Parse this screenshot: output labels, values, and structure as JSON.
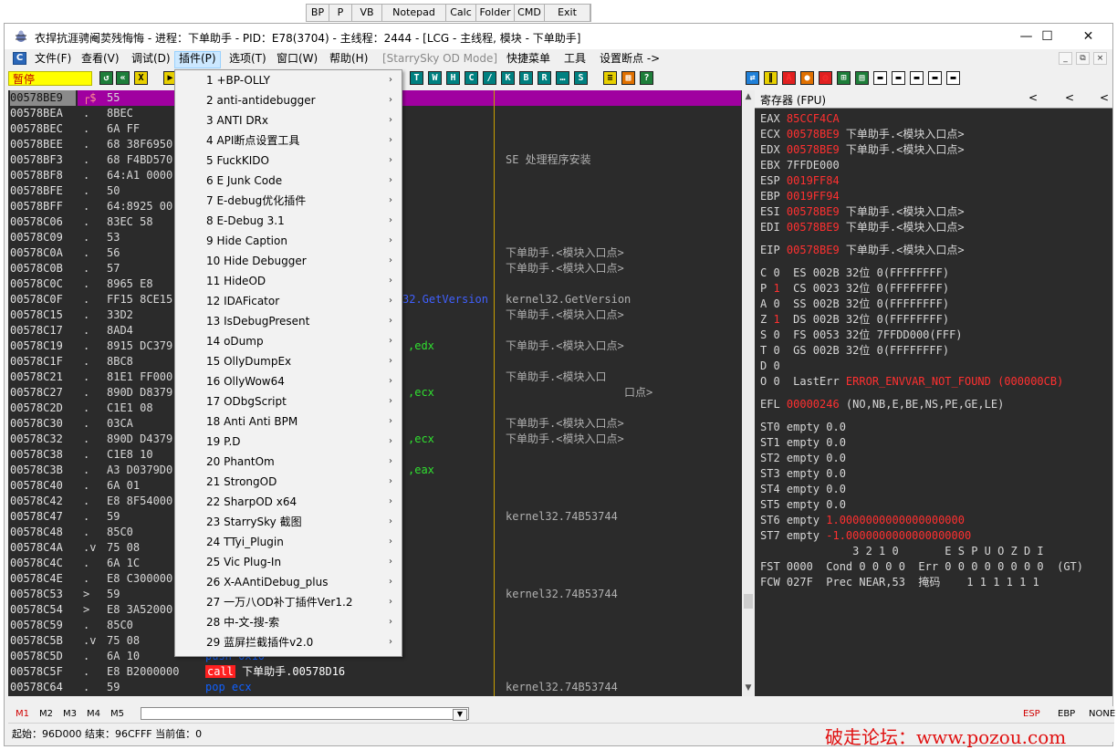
{
  "ext_toolbar": [
    "BP",
    "P",
    "VB",
    "Notepad",
    "Calc",
    "Folder",
    "CMD",
    "Exit"
  ],
  "window": {
    "title": "衣捍抗涯骋阉荬残悔悔 - 进程：下单助手 - PID：E78(3704) - 主线程：2444 - [LCG - 主线程, 模块 - 下单助手]",
    "controls": {
      "minimize": "—",
      "maximize": "☐",
      "close": "✕"
    }
  },
  "menubar": {
    "items": [
      "文件(F)",
      "查看(V)",
      "调试(D)",
      "插件(P)",
      "选项(T)",
      "窗口(W)",
      "帮助(H)",
      "[StarrySky OD Mode]",
      "快捷菜单",
      "工具",
      "设置断点 ->"
    ],
    "selected": "插件(P)",
    "disabled": "[StarrySky OD Mode]"
  },
  "toolbar": {
    "status": "暂停",
    "buttons_a": [
      "◀",
      "«",
      "X",
      "▶"
    ],
    "letter_buttons": [
      "T",
      "W",
      "H",
      "C",
      "/",
      "K",
      "B",
      "R",
      "...",
      "S"
    ]
  },
  "plugin_menu": [
    "1 +BP-OLLY",
    "2 anti-antidebugger",
    "3 ANTI DRx",
    "4 API断点设置工具",
    "5 FuckKIDO",
    "6 E Junk Code",
    "7 E-debug优化插件",
    "8 E-Debug 3.1",
    "9 Hide Caption",
    "10 Hide Debugger",
    "11 HideOD",
    "12 IDAFicator",
    "13 IsDebugPresent",
    "14 oDump",
    "15 OllyDumpEx",
    "16 OllyWow64",
    "17 ODbgScript",
    "18 Anti Anti BPM",
    "19 P.D",
    "20 PhantOm",
    "21 StrongOD",
    "22 SharpOD x64",
    "23 StarrySky 截图",
    "24 TTyi_Plugin",
    "25 Vic Plug-In",
    "26 X-AAntiDebug_plus",
    "27 一万八OD补丁插件Ver1.2",
    "28 中-文-搜-索",
    "29 蓝屏拦截插件v2.0"
  ],
  "disasm": {
    "rows": [
      {
        "addr": "00578BE9",
        "mark": "┌$",
        "hex": "55",
        "asm": "",
        "cmt": ""
      },
      {
        "addr": "00578BEA",
        "mark": ".",
        "hex": "8BEC",
        "asm": "",
        "cmt": ""
      },
      {
        "addr": "00578BEC",
        "mark": ".",
        "hex": "6A FF",
        "asm": "",
        "cmt": ""
      },
      {
        "addr": "00578BEE",
        "mark": ".",
        "hex": "68 38F6950",
        "asm": "",
        "cmt": ""
      },
      {
        "addr": "00578BF3",
        "mark": ".",
        "hex": "68 F4BD570",
        "asm": "",
        "cmt": "SE 处理程序安装"
      },
      {
        "addr": "00578BF8",
        "mark": ".",
        "hex": "64:A1 0000",
        "asm": "",
        "cmt": ""
      },
      {
        "addr": "00578BFE",
        "mark": ".",
        "hex": "50",
        "asm": "",
        "cmt": ""
      },
      {
        "addr": "00578BFF",
        "mark": ".",
        "hex": "64:8925 00",
        "asm": "",
        "cmt": ""
      },
      {
        "addr": "00578C06",
        "mark": ".",
        "hex": "83EC 58",
        "asm": "",
        "cmt": ""
      },
      {
        "addr": "00578C09",
        "mark": ".",
        "hex": "53",
        "asm": "",
        "cmt": ""
      },
      {
        "addr": "00578C0A",
        "mark": ".",
        "hex": "56",
        "asm": "",
        "cmt": "下单助手.<模块入口点>"
      },
      {
        "addr": "00578C0B",
        "mark": ".",
        "hex": "57",
        "asm": "",
        "cmt": "下单助手.<模块入口点>"
      },
      {
        "addr": "00578C0C",
        "mark": ".",
        "hex": "8965 E8",
        "asm": "",
        "cmt": ""
      },
      {
        "addr": "00578C0F",
        "mark": ".",
        "hex": "FF15 8CE15",
        "asm": "32.GetVersion",
        "cmt": "kernel32.GetVersion"
      },
      {
        "addr": "00578C15",
        "mark": ".",
        "hex": "33D2",
        "asm": "",
        "cmt": "下单助手.<模块入口点>"
      },
      {
        "addr": "00578C17",
        "mark": ".",
        "hex": "8AD4",
        "asm": "",
        "cmt": ""
      },
      {
        "addr": "00578C19",
        "mark": ".",
        "hex": "8915 DC379",
        "asm": ",edx",
        "cmt": "下单助手.<模块入口点>"
      },
      {
        "addr": "00578C1F",
        "mark": ".",
        "hex": "8BC8",
        "asm": "",
        "cmt": ""
      },
      {
        "addr": "00578C21",
        "mark": ".",
        "hex": "81E1 FF000",
        "asm": "",
        "cmt": "下单助手.<模块入口"
      },
      {
        "addr": "00578C27",
        "mark": ".",
        "hex": "890D D8379",
        "asm": ",ecx",
        "cmt": "口点>"
      },
      {
        "addr": "00578C2D",
        "mark": ".",
        "hex": "C1E1 08",
        "asm": "",
        "cmt": ""
      },
      {
        "addr": "00578C30",
        "mark": ".",
        "hex": "03CA",
        "asm": "",
        "cmt": "下单助手.<模块入口点>"
      },
      {
        "addr": "00578C32",
        "mark": ".",
        "hex": "890D D4379",
        "asm": ",ecx",
        "cmt": "下单助手.<模块入口点>"
      },
      {
        "addr": "00578C38",
        "mark": ".",
        "hex": "C1E8 10",
        "asm": "",
        "cmt": ""
      },
      {
        "addr": "00578C3B",
        "mark": ".",
        "hex": "A3 D0379D0",
        "asm": ",eax",
        "cmt": ""
      },
      {
        "addr": "00578C40",
        "mark": ".",
        "hex": "6A 01",
        "asm": "",
        "cmt": ""
      },
      {
        "addr": "00578C42",
        "mark": ".",
        "hex": "E8 8F54000",
        "asm": "",
        "cmt": ""
      },
      {
        "addr": "00578C47",
        "mark": ".",
        "hex": "59",
        "asm": "",
        "cmt": "kernel32.74B53744"
      },
      {
        "addr": "00578C48",
        "mark": ".",
        "hex": "85C0",
        "asm": "",
        "cmt": ""
      },
      {
        "addr": "00578C4A",
        "mark": ".v",
        "hex": "75 08",
        "asm": "",
        "cmt": ""
      },
      {
        "addr": "00578C4C",
        "mark": ".",
        "hex": "6A 1C",
        "asm": "",
        "cmt": ""
      },
      {
        "addr": "00578C4E",
        "mark": ".",
        "hex": "E8 C300000",
        "asm": "",
        "cmt": ""
      },
      {
        "addr": "00578C53",
        "mark": ">",
        "hex": "59",
        "asm": "",
        "cmt": "kernel32.74B53744"
      },
      {
        "addr": "00578C54",
        "mark": ">",
        "hex": "E8 3A52000",
        "asm": "",
        "cmt": ""
      },
      {
        "addr": "00578C59",
        "mark": ".",
        "hex": "85C0",
        "asm": "",
        "cmt": ""
      },
      {
        "addr": "00578C5B",
        "mark": ".v",
        "hex": "75 08",
        "asm": "",
        "cmt": ""
      },
      {
        "addr": "00578C5D",
        "mark": ".",
        "hex": "6A 10",
        "asm": "push 0x10",
        "cmt": ""
      },
      {
        "addr": "00578C5F",
        "mark": ".",
        "hex": "E8 B2000000",
        "asm": "call 下单助手.00578D16",
        "cmt": ""
      },
      {
        "addr": "00578C64",
        "mark": ".",
        "hex": "59",
        "asm": "pop ecx",
        "cmt": "kernel32.74B53744"
      }
    ]
  },
  "registers": {
    "title": "寄存器 (FPU)",
    "nav": [
      "<",
      "<",
      "<"
    ],
    "lines": [
      "EAX 85CCF4CA",
      "ECX 00578BE9 下单助手.<模块入口点>",
      "EDX 00578BE9 下单助手.<模块入口点>",
      "EBX 7FFDE000",
      "ESP 0019FF84",
      "EBP 0019FF94",
      "ESI 00578BE9 下单助手.<模块入口点>",
      "EDI 00578BE9 下单助手.<模块入口点>",
      "",
      "EIP 00578BE9 下单助手.<模块入口点>",
      "",
      "C 0  ES 002B 32位 0(FFFFFFFF)",
      "P 1  CS 0023 32位 0(FFFFFFFF)",
      "A 0  SS 002B 32位 0(FFFFFFFF)",
      "Z 1  DS 002B 32位 0(FFFFFFFF)",
      "S 0  FS 0053 32位 7FFDD000(FFF)",
      "T 0  GS 002B 32位 0(FFFFFFFF)",
      "D 0",
      "O 0  LastErr ERROR_ENVVAR_NOT_FOUND (000000CB)",
      "",
      "EFL 00000246 (NO,NB,E,BE,NS,PE,GE,LE)",
      "",
      "ST0 empty 0.0",
      "ST1 empty 0.0",
      "ST2 empty 0.0",
      "ST3 empty 0.0",
      "ST4 empty 0.0",
      "ST5 empty 0.0",
      "ST6 empty 1.0000000000000000000",
      "ST7 empty -1.0000000000000000000",
      "              3 2 1 0       E S P U O Z D I",
      "FST 0000  Cond 0 0 0 0  Err 0 0 0 0 0 0 0 0  (GT)",
      "FCW 027F  Prec NEAR,53  掩码    1 1 1 1 1 1"
    ]
  },
  "cmdbar": {
    "tabs": [
      "M1",
      "M2",
      "M3",
      "M4",
      "M5"
    ],
    "right": [
      "ESP",
      "EBP",
      "NONE"
    ]
  },
  "statusbar": {
    "text": "起始：96D000 结束：96CFFF 当前值：0"
  },
  "watermark": "破走论坛：www.pozou.com",
  "colors": {
    "accent_red": "#ff3030",
    "selection_purple": "#a000a0",
    "paused_yellow": "#ffff00",
    "menu_hover": "#cce8ff"
  }
}
